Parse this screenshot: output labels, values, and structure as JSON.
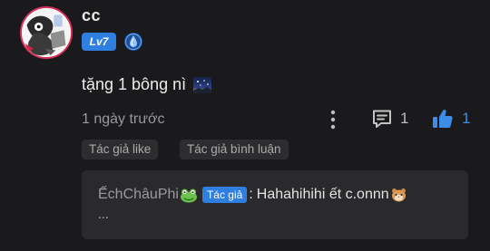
{
  "comment": {
    "username": "cc",
    "level_badge": "Lv7",
    "rank_icon": "droplet-shield-icon",
    "text": "tặng 1 bông nì",
    "emoji": "night-sky-emoji",
    "time": "1 ngày trước",
    "reply_count": "1",
    "like_count": "1",
    "tags": [
      "Tác giả like",
      "Tác giả bình luận"
    ]
  },
  "reply": {
    "author": "ẾchChâuPhi",
    "author_emoji": "frog-emoji",
    "author_badge": "Tác giả",
    "separator": ":",
    "text": "Hahahihihi ết c.onnn",
    "text_emoji": "hamster-emoji",
    "more": "..."
  },
  "colors": {
    "background": "#1a1a1c",
    "accent_blue": "#2f7fe0",
    "like_blue": "#3c8de8",
    "avatar_ring": "#d62f57",
    "reply_box": "#2a2a2d"
  }
}
